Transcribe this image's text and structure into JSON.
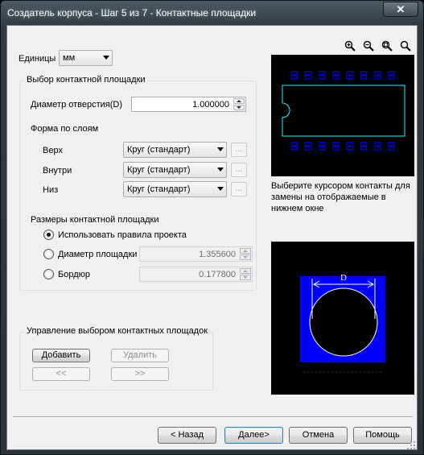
{
  "window": {
    "title": "Создатель корпуса - Шаг 5 из 7 - Контактные площадки",
    "close_glyph": "✕"
  },
  "units": {
    "label": "Единицы",
    "value": "мм"
  },
  "pad_selection": {
    "title": "Выбор контактной площадки",
    "hole_diameter_label": "Диаметр отверстия(D)",
    "hole_diameter_value": "1.000000",
    "shape_by_layer_label": "Форма по слоям",
    "layers": [
      {
        "label": "Верх",
        "value": "Круг (стандарт)"
      },
      {
        "label": "Внутри",
        "value": "Круг (стандарт)"
      },
      {
        "label": "Низ",
        "value": "Круг (стандарт)"
      }
    ],
    "ellipsis": "...",
    "pad_sizes_label": "Размеры контактной площадки",
    "use_rules_label": "Использовать правила проекта",
    "pad_diameter_label": "Диаметр площадки",
    "pad_diameter_value": "1.355600",
    "annular_label": "Бордюр",
    "annular_value": "0.177800",
    "selected_option": "use_rules"
  },
  "pad_management": {
    "title": "Управление выбором контактных площадок",
    "add_label": "Добавить",
    "remove_label": "Удалить",
    "prev_label": "<<",
    "next_label": ">>"
  },
  "preview": {
    "hint": "Выберите курсором контакты для замены на отображаемые в нижнем окне",
    "dimension_label": "D",
    "zoom_icons": [
      "zoom-in-icon",
      "zoom-out-icon",
      "zoom-fit-icon",
      "zoom-area-icon"
    ],
    "colors": {
      "background": "#000000",
      "outline": "#00ffff",
      "pad_pin": "#0000ff",
      "pad_preview": "#0000ff",
      "hole": "#000000"
    },
    "top_pins_count": 8,
    "bottom_pins_count": 8
  },
  "footer": {
    "back_label": "< Назад",
    "next_label": "Далее>",
    "cancel_label": "Отмена",
    "help_label": "Помощь"
  }
}
